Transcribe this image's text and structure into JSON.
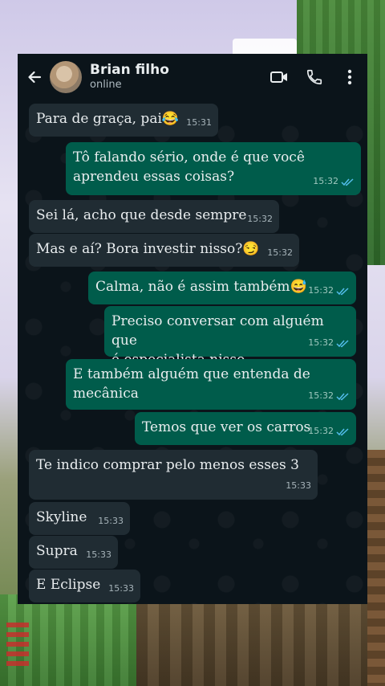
{
  "header": {
    "contact_name": "Brian filho",
    "status": "online",
    "icons": [
      "back-arrow-icon",
      "video-call-icon",
      "phone-icon",
      "more-vertical-icon"
    ]
  },
  "colors": {
    "chat_bg": "#0b141a",
    "incoming_bubble": "#202c33",
    "outgoing_bubble": "#005c4b",
    "read_tick": "#53bdeb"
  },
  "messages": [
    {
      "dir": "in",
      "text": "Para de graça, pai😂",
      "time": "15:31"
    },
    {
      "dir": "out",
      "text": "Tô falando sério, onde é que você\naprendeu essas coisas?",
      "time": "15:32",
      "status": "read"
    },
    {
      "dir": "in",
      "text": "Sei lá, acho que desde sempre",
      "time": "15:32"
    },
    {
      "dir": "in",
      "text": "Mas e aí? Bora investir nisso?😏",
      "time": "15:32"
    },
    {
      "dir": "out",
      "text": "Calma, não é assim também😅",
      "time": "15:32",
      "status": "read"
    },
    {
      "dir": "out",
      "text": "Preciso conversar com alguém que\né especialista nisso",
      "time": "15:32",
      "status": "read"
    },
    {
      "dir": "out",
      "text": "E também alguém que entenda de\nmecânica",
      "time": "15:32",
      "status": "read"
    },
    {
      "dir": "out",
      "text": "Temos que ver os carros",
      "time": "15:32",
      "status": "read"
    },
    {
      "dir": "in",
      "text": "Te indico comprar pelo menos esses 3",
      "time": "15:33"
    },
    {
      "dir": "in",
      "text": "Skyline",
      "time": "15:33"
    },
    {
      "dir": "in",
      "text": "Supra",
      "time": "15:33"
    },
    {
      "dir": "in",
      "text": "E Eclipse",
      "time": "15:33"
    }
  ]
}
